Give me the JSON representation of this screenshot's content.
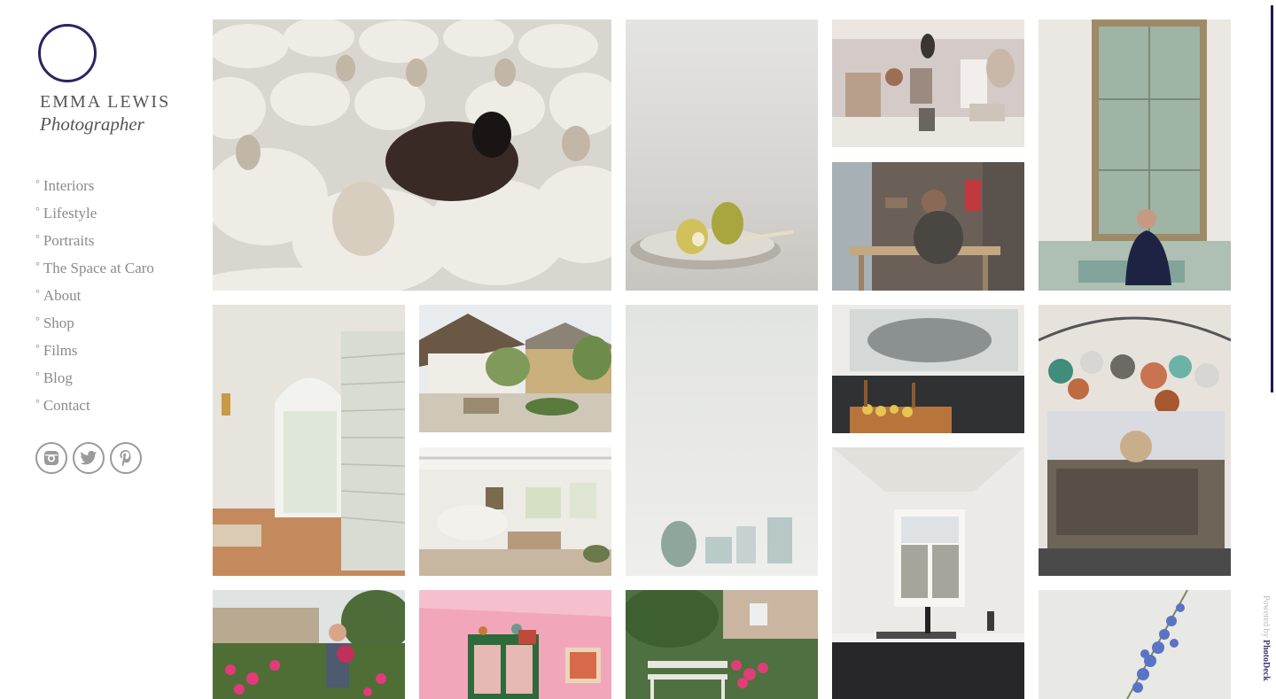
{
  "logo": {
    "name": "EMMA LEWIS",
    "subtitle": "Photographer"
  },
  "nav": [
    "Interiors",
    "Lifestyle",
    "Portraits",
    "The Space at Caro",
    "About",
    "Shop",
    "Films",
    "Blog",
    "Contact"
  ],
  "social": [
    "instagram-icon",
    "twitter-icon",
    "pinterest-icon"
  ],
  "footer": {
    "powered_by": "Powered by",
    "brand": "PhotoDeck"
  },
  "colors": {
    "accent": "#2c2461",
    "nav_text": "#8a8a8a"
  },
  "gallery": [
    "sheep-flock-photo",
    "pear-plate-photo",
    "grand-room-photo",
    "carpenter-workshop-photo",
    "man-mirror-portrait-photo",
    "arched-door-hallway-photo",
    "thatched-cottage-photo",
    "misty-pottery-photo",
    "kitchen-fish-painting-photo",
    "stone-sink-pans-photo",
    "white-living-room-photo",
    "kitchen-window-photo",
    "dahlia-garden-woman-photo",
    "pink-room-cabinet-photo",
    "garden-bench-photo",
    "delphinium-flower-photo"
  ]
}
